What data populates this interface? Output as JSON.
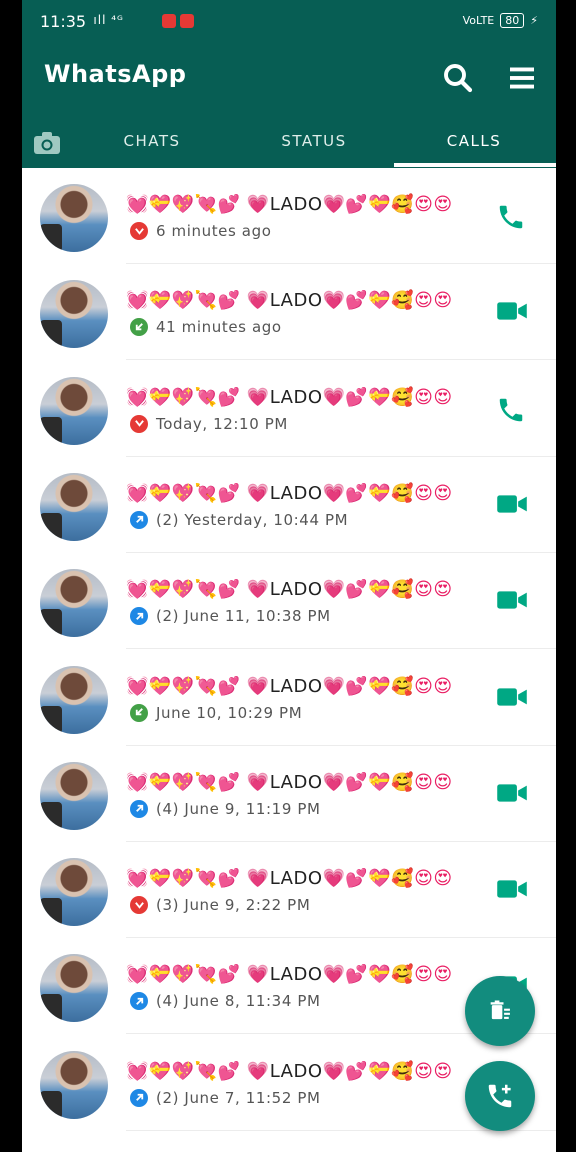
{
  "status_bar": {
    "time": "11:35",
    "signal_text": " ıll ⁴ᴳ",
    "volte": "VoLTE",
    "battery": "80"
  },
  "app_bar": {
    "title": "WhatsApp",
    "tabs": [
      "CHATS",
      "STATUS",
      "CALLS"
    ],
    "selected_tab": "CALLS"
  },
  "contact": {
    "name_prefix": "💓💝💖💘💕 💗",
    "name_text": "LADO",
    "name_suffix": "💗💕💝🥰😍😍"
  },
  "calls": [
    {
      "direction": "missed",
      "meta": "6 minutes ago",
      "type": "voice"
    },
    {
      "direction": "incoming",
      "meta": "41 minutes ago",
      "type": "video"
    },
    {
      "direction": "missed",
      "meta": "Today, 12:10 PM",
      "type": "voice"
    },
    {
      "direction": "outgoing",
      "meta": "(2)  Yesterday, 10:44 PM",
      "type": "video"
    },
    {
      "direction": "outgoing",
      "meta": "(2)  June 11, 10:38 PM",
      "type": "video"
    },
    {
      "direction": "incoming",
      "meta": "June 10, 10:29 PM",
      "type": "video"
    },
    {
      "direction": "outgoing",
      "meta": "(4)  June 9, 11:19 PM",
      "type": "video"
    },
    {
      "direction": "missed",
      "meta": "(3)  June 9, 2:22 PM",
      "type": "video"
    },
    {
      "direction": "outgoing",
      "meta": "(4)  June 8, 11:34 PM",
      "type": "video"
    },
    {
      "direction": "outgoing",
      "meta": "(2)  June 7, 11:52 PM",
      "type": "voice"
    }
  ],
  "icons": {
    "search": "search-icon",
    "menu": "menu-icon",
    "camera": "camera-icon",
    "voice_call": "phone-icon",
    "video_call": "video-camera-icon",
    "clear_log": "clear-call-log-icon",
    "new_call": "add-call-icon"
  },
  "colors": {
    "brand": "#075e54",
    "accent": "#128c7e",
    "call_icon": "#00a884",
    "missed": "#e53935",
    "incoming": "#43a047",
    "outgoing": "#1e88e5"
  }
}
